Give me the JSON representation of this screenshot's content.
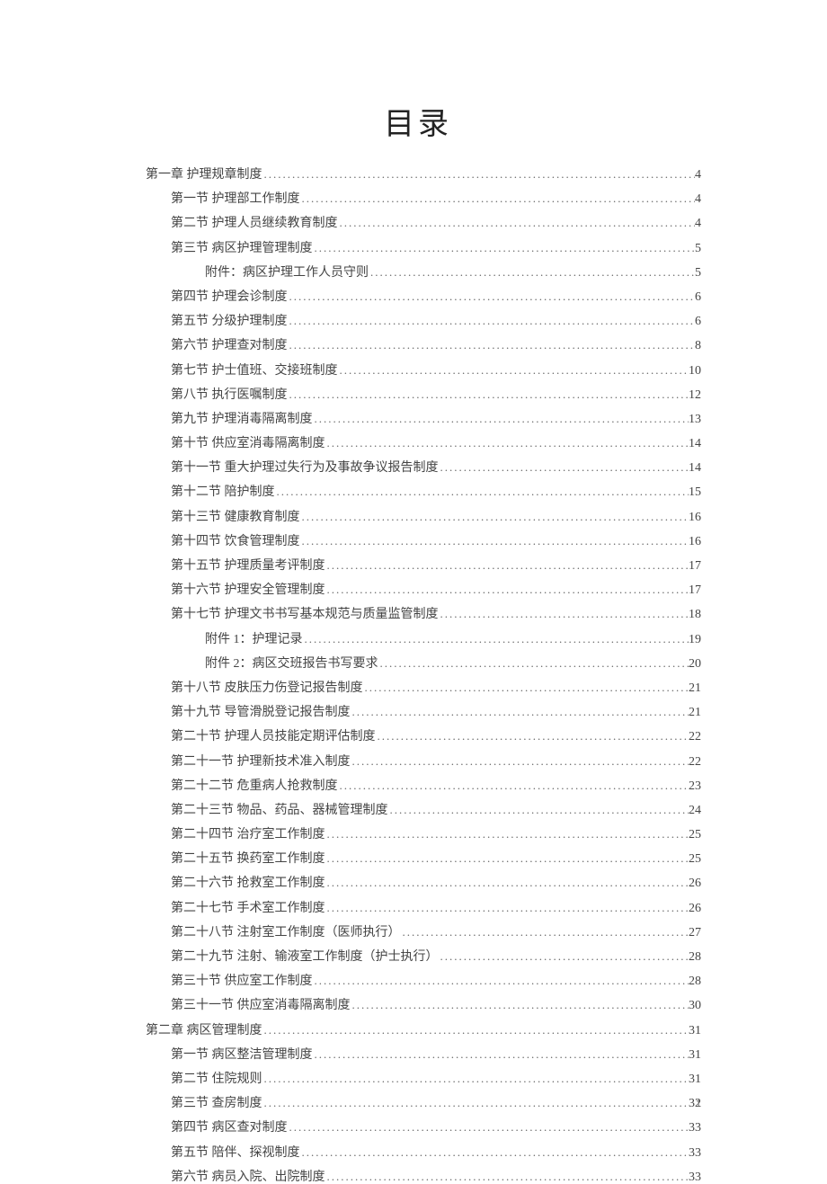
{
  "title": "目录",
  "page_number": "1",
  "toc": [
    {
      "level": 0,
      "label": "第一章 护理规章制度",
      "page": "4"
    },
    {
      "level": 1,
      "label": "第一节 护理部工作制度",
      "page": "4"
    },
    {
      "level": 1,
      "label": "第二节 护理人员继续教育制度",
      "page": "4"
    },
    {
      "level": 1,
      "label": "第三节 病区护理管理制度",
      "page": "5"
    },
    {
      "level": 2,
      "label": "附件：病区护理工作人员守则",
      "page": "5"
    },
    {
      "level": 1,
      "label": "第四节 护理会诊制度",
      "page": "6"
    },
    {
      "level": 1,
      "label": "第五节 分级护理制度",
      "page": "6"
    },
    {
      "level": 1,
      "label": "第六节 护理查对制度",
      "page": "8"
    },
    {
      "level": 1,
      "label": "第七节 护士值班、交接班制度",
      "page": "10"
    },
    {
      "level": 1,
      "label": "第八节 执行医嘱制度",
      "page": "12"
    },
    {
      "level": 1,
      "label": "第九节 护理消毒隔离制度",
      "page": "13"
    },
    {
      "level": 1,
      "label": "第十节 供应室消毒隔离制度",
      "page": "14"
    },
    {
      "level": 1,
      "label": "第十一节 重大护理过失行为及事故争议报告制度",
      "page": "14"
    },
    {
      "level": 1,
      "label": "第十二节 陪护制度",
      "page": "15"
    },
    {
      "level": 1,
      "label": "第十三节 健康教育制度",
      "page": "16"
    },
    {
      "level": 1,
      "label": "第十四节 饮食管理制度",
      "page": "16"
    },
    {
      "level": 1,
      "label": "第十五节 护理质量考评制度",
      "page": "17"
    },
    {
      "level": 1,
      "label": "第十六节 护理安全管理制度",
      "page": "17"
    },
    {
      "level": 1,
      "label": "第十七节 护理文书书写基本规范与质量监管制度",
      "page": "18"
    },
    {
      "level": 2,
      "label": "附件 1：护理记录",
      "page": "19"
    },
    {
      "level": 2,
      "label": "附件 2：病区交班报告书写要求",
      "page": "20"
    },
    {
      "level": 1,
      "label": "第十八节 皮肤压力伤登记报告制度",
      "page": "21"
    },
    {
      "level": 1,
      "label": "第十九节 导管滑脱登记报告制度",
      "page": "21"
    },
    {
      "level": 1,
      "label": "第二十节 护理人员技能定期评估制度",
      "page": "22"
    },
    {
      "level": 1,
      "label": "第二十一节 护理新技术准入制度",
      "page": "22"
    },
    {
      "level": 1,
      "label": "第二十二节 危重病人抢救制度",
      "page": "23"
    },
    {
      "level": 1,
      "label": "第二十三节 物品、药品、器械管理制度",
      "page": "24"
    },
    {
      "level": 1,
      "label": "第二十四节 治疗室工作制度",
      "page": "25"
    },
    {
      "level": 1,
      "label": "第二十五节 换药室工作制度",
      "page": "25"
    },
    {
      "level": 1,
      "label": "第二十六节 抢救室工作制度",
      "page": "26"
    },
    {
      "level": 1,
      "label": "第二十七节 手术室工作制度",
      "page": "26"
    },
    {
      "level": 1,
      "label": "第二十八节 注射室工作制度（医师执行）",
      "page": "27"
    },
    {
      "level": 1,
      "label": "第二十九节 注射、输液室工作制度（护士执行）",
      "page": "28"
    },
    {
      "level": 1,
      "label": "第三十节 供应室工作制度",
      "page": "28"
    },
    {
      "level": 1,
      "label": "第三十一节 供应室消毒隔离制度",
      "page": "30"
    },
    {
      "level": 0,
      "label": "第二章 病区管理制度",
      "page": "31"
    },
    {
      "level": 1,
      "label": "第一节 病区整洁管理制度",
      "page": "31"
    },
    {
      "level": 1,
      "label": "第二节 住院规则",
      "page": "31"
    },
    {
      "level": 1,
      "label": "第三节 查房制度",
      "page": "32"
    },
    {
      "level": 1,
      "label": "第四节 病区查对制度",
      "page": "33"
    },
    {
      "level": 1,
      "label": "第五节 陪伴、探视制度",
      "page": "33"
    },
    {
      "level": 1,
      "label": "第六节 病员入院、出院制度",
      "page": "33"
    }
  ]
}
